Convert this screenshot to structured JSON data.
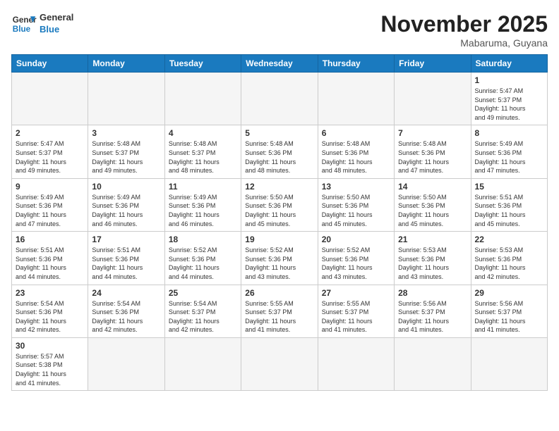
{
  "header": {
    "logo_general": "General",
    "logo_blue": "Blue",
    "month_title": "November 2025",
    "location": "Mabaruma, Guyana"
  },
  "weekdays": [
    "Sunday",
    "Monday",
    "Tuesday",
    "Wednesday",
    "Thursday",
    "Friday",
    "Saturday"
  ],
  "weeks": [
    [
      {
        "day": "",
        "info": ""
      },
      {
        "day": "",
        "info": ""
      },
      {
        "day": "",
        "info": ""
      },
      {
        "day": "",
        "info": ""
      },
      {
        "day": "",
        "info": ""
      },
      {
        "day": "",
        "info": ""
      },
      {
        "day": "1",
        "info": "Sunrise: 5:47 AM\nSunset: 5:37 PM\nDaylight: 11 hours\nand 49 minutes."
      }
    ],
    [
      {
        "day": "2",
        "info": "Sunrise: 5:47 AM\nSunset: 5:37 PM\nDaylight: 11 hours\nand 49 minutes."
      },
      {
        "day": "3",
        "info": "Sunrise: 5:48 AM\nSunset: 5:37 PM\nDaylight: 11 hours\nand 49 minutes."
      },
      {
        "day": "4",
        "info": "Sunrise: 5:48 AM\nSunset: 5:37 PM\nDaylight: 11 hours\nand 48 minutes."
      },
      {
        "day": "5",
        "info": "Sunrise: 5:48 AM\nSunset: 5:36 PM\nDaylight: 11 hours\nand 48 minutes."
      },
      {
        "day": "6",
        "info": "Sunrise: 5:48 AM\nSunset: 5:36 PM\nDaylight: 11 hours\nand 48 minutes."
      },
      {
        "day": "7",
        "info": "Sunrise: 5:48 AM\nSunset: 5:36 PM\nDaylight: 11 hours\nand 47 minutes."
      },
      {
        "day": "8",
        "info": "Sunrise: 5:49 AM\nSunset: 5:36 PM\nDaylight: 11 hours\nand 47 minutes."
      }
    ],
    [
      {
        "day": "9",
        "info": "Sunrise: 5:49 AM\nSunset: 5:36 PM\nDaylight: 11 hours\nand 47 minutes."
      },
      {
        "day": "10",
        "info": "Sunrise: 5:49 AM\nSunset: 5:36 PM\nDaylight: 11 hours\nand 46 minutes."
      },
      {
        "day": "11",
        "info": "Sunrise: 5:49 AM\nSunset: 5:36 PM\nDaylight: 11 hours\nand 46 minutes."
      },
      {
        "day": "12",
        "info": "Sunrise: 5:50 AM\nSunset: 5:36 PM\nDaylight: 11 hours\nand 45 minutes."
      },
      {
        "day": "13",
        "info": "Sunrise: 5:50 AM\nSunset: 5:36 PM\nDaylight: 11 hours\nand 45 minutes."
      },
      {
        "day": "14",
        "info": "Sunrise: 5:50 AM\nSunset: 5:36 PM\nDaylight: 11 hours\nand 45 minutes."
      },
      {
        "day": "15",
        "info": "Sunrise: 5:51 AM\nSunset: 5:36 PM\nDaylight: 11 hours\nand 45 minutes."
      }
    ],
    [
      {
        "day": "16",
        "info": "Sunrise: 5:51 AM\nSunset: 5:36 PM\nDaylight: 11 hours\nand 44 minutes."
      },
      {
        "day": "17",
        "info": "Sunrise: 5:51 AM\nSunset: 5:36 PM\nDaylight: 11 hours\nand 44 minutes."
      },
      {
        "day": "18",
        "info": "Sunrise: 5:52 AM\nSunset: 5:36 PM\nDaylight: 11 hours\nand 44 minutes."
      },
      {
        "day": "19",
        "info": "Sunrise: 5:52 AM\nSunset: 5:36 PM\nDaylight: 11 hours\nand 43 minutes."
      },
      {
        "day": "20",
        "info": "Sunrise: 5:52 AM\nSunset: 5:36 PM\nDaylight: 11 hours\nand 43 minutes."
      },
      {
        "day": "21",
        "info": "Sunrise: 5:53 AM\nSunset: 5:36 PM\nDaylight: 11 hours\nand 43 minutes."
      },
      {
        "day": "22",
        "info": "Sunrise: 5:53 AM\nSunset: 5:36 PM\nDaylight: 11 hours\nand 42 minutes."
      }
    ],
    [
      {
        "day": "23",
        "info": "Sunrise: 5:54 AM\nSunset: 5:36 PM\nDaylight: 11 hours\nand 42 minutes."
      },
      {
        "day": "24",
        "info": "Sunrise: 5:54 AM\nSunset: 5:36 PM\nDaylight: 11 hours\nand 42 minutes."
      },
      {
        "day": "25",
        "info": "Sunrise: 5:54 AM\nSunset: 5:37 PM\nDaylight: 11 hours\nand 42 minutes."
      },
      {
        "day": "26",
        "info": "Sunrise: 5:55 AM\nSunset: 5:37 PM\nDaylight: 11 hours\nand 41 minutes."
      },
      {
        "day": "27",
        "info": "Sunrise: 5:55 AM\nSunset: 5:37 PM\nDaylight: 11 hours\nand 41 minutes."
      },
      {
        "day": "28",
        "info": "Sunrise: 5:56 AM\nSunset: 5:37 PM\nDaylight: 11 hours\nand 41 minutes."
      },
      {
        "day": "29",
        "info": "Sunrise: 5:56 AM\nSunset: 5:37 PM\nDaylight: 11 hours\nand 41 minutes."
      }
    ],
    [
      {
        "day": "30",
        "info": "Sunrise: 5:57 AM\nSunset: 5:38 PM\nDaylight: 11 hours\nand 41 minutes."
      },
      {
        "day": "",
        "info": ""
      },
      {
        "day": "",
        "info": ""
      },
      {
        "day": "",
        "info": ""
      },
      {
        "day": "",
        "info": ""
      },
      {
        "day": "",
        "info": ""
      },
      {
        "day": "",
        "info": ""
      }
    ]
  ]
}
